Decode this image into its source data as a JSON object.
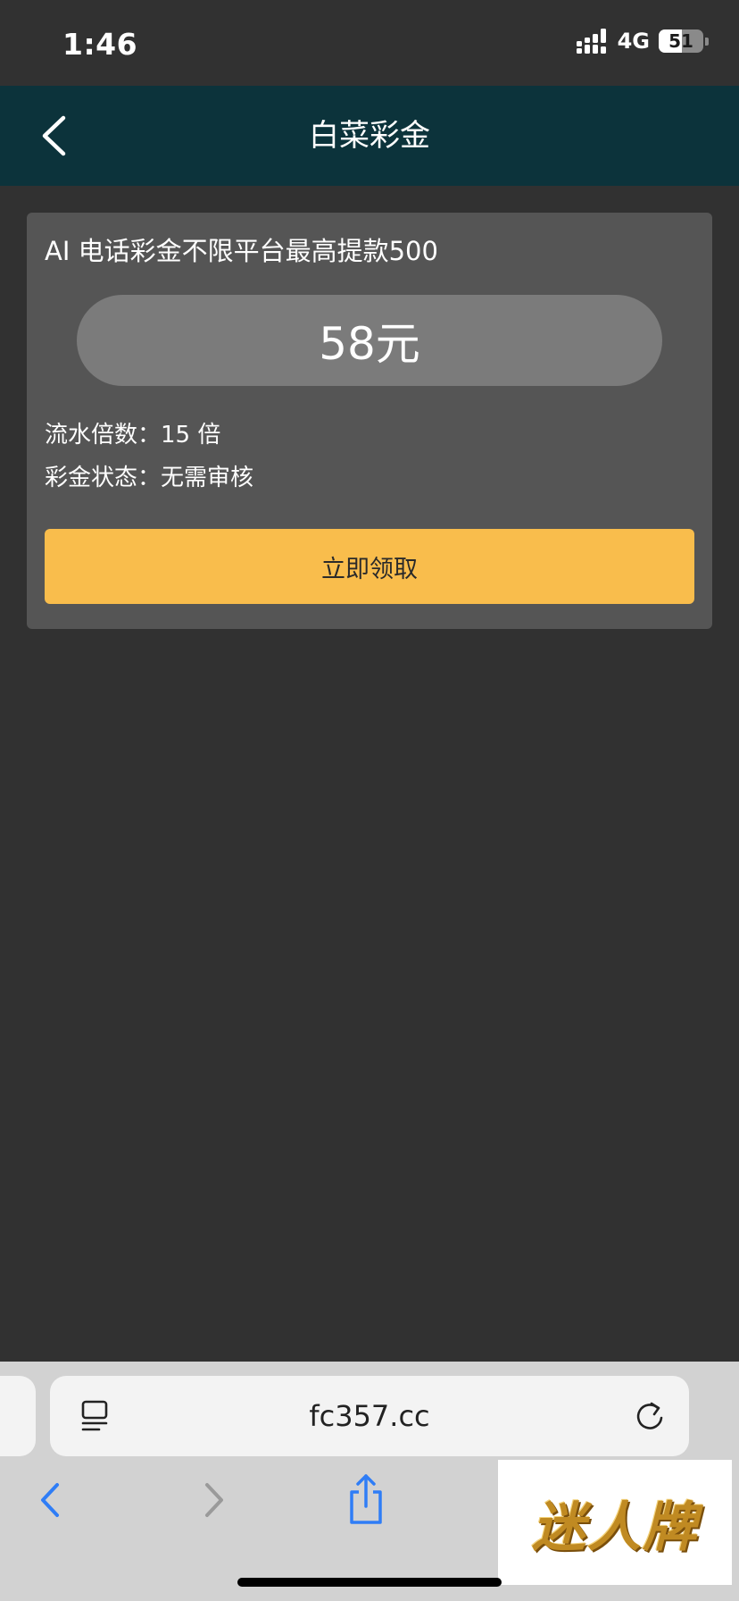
{
  "status_bar": {
    "time": "1:46",
    "network": "4G",
    "battery": "51"
  },
  "nav": {
    "title": "白菜彩金"
  },
  "card": {
    "title": "AI 电话彩金不限平台最高提款500",
    "amount": "58元",
    "turnover_label": "流水倍数：",
    "turnover_value": "15 倍",
    "status_label": "彩金状态：",
    "status_value": "无需审核",
    "claim_label": "立即领取"
  },
  "browser": {
    "url": "fc357.cc"
  },
  "watermark": {
    "text": "迷人牌"
  },
  "colors": {
    "background": "#313131",
    "nav": "#0c333b",
    "card": "#555555",
    "pill": "#7b7b7b",
    "accent": "#f9bd4c",
    "browser_blue": "#2f7df6"
  }
}
